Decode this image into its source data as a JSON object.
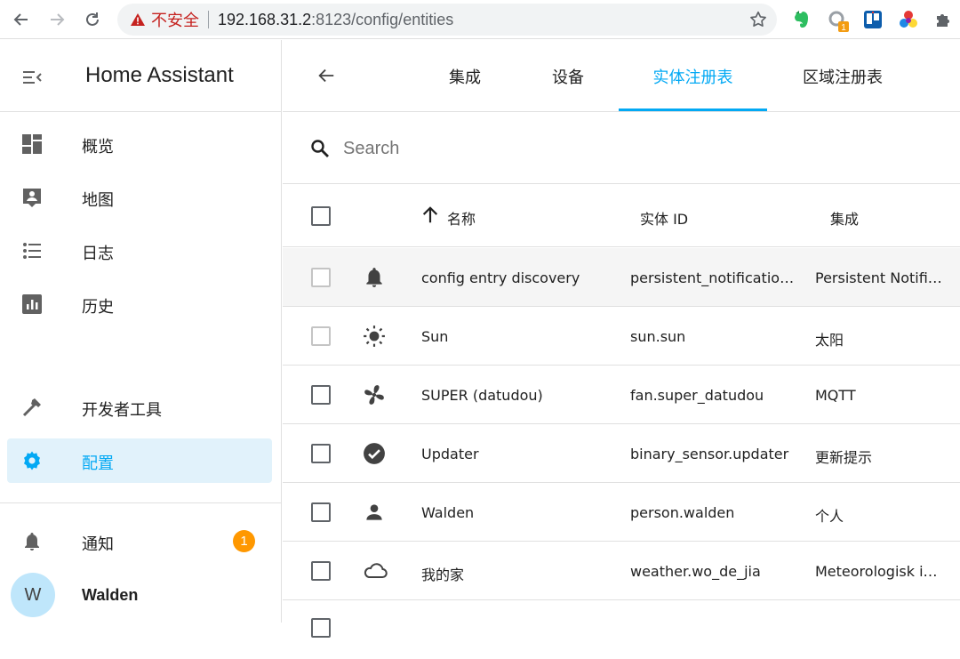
{
  "browser": {
    "insecure_label": "不安全",
    "url_host": "192.168.31.2",
    "url_rest": ":8123/config/entities",
    "ext_badge": "1"
  },
  "sidebar": {
    "title": "Home Assistant",
    "items": [
      {
        "label": "概览",
        "icon": "dashboard-icon"
      },
      {
        "label": "地图",
        "icon": "map-account-icon"
      },
      {
        "label": "日志",
        "icon": "list-icon"
      },
      {
        "label": "历史",
        "icon": "chart-box-icon"
      },
      {
        "label": "开发者工具",
        "icon": "hammer-icon"
      },
      {
        "label": "配置",
        "icon": "cog-icon"
      },
      {
        "label": "通知",
        "icon": "bell-icon"
      }
    ],
    "notification_count": "1",
    "user": {
      "initial": "W",
      "name": "Walden"
    },
    "accent": "#03a9f4"
  },
  "main": {
    "tabs": [
      {
        "label": "集成"
      },
      {
        "label": "设备"
      },
      {
        "label": "实体注册表"
      },
      {
        "label": "区域注册表"
      }
    ],
    "active_tab": "实体注册表",
    "search": {
      "placeholder": "Search",
      "value": ""
    },
    "columns": {
      "name": "名称",
      "entity_id": "实体 ID",
      "integration": "集成"
    },
    "rows": [
      {
        "name": "config entry discovery",
        "entity_id": "persistent_notificatio…",
        "integration": "Persistent Notifi…",
        "icon": "bell-icon"
      },
      {
        "name": "Sun",
        "entity_id": "sun.sun",
        "integration": "太阳",
        "icon": "sun-icon"
      },
      {
        "name": "SUPER (datudou)",
        "entity_id": "fan.super_datudou",
        "integration": "MQTT",
        "icon": "fan-icon"
      },
      {
        "name": "Updater",
        "entity_id": "binary_sensor.updater",
        "integration": "更新提示",
        "icon": "check-circle-icon"
      },
      {
        "name": "Walden",
        "entity_id": "person.walden",
        "integration": "个人",
        "icon": "person-icon"
      },
      {
        "name": "我的家",
        "entity_id": "weather.wo_de_jia",
        "integration": "Meteorologisk i…",
        "icon": "cloud-icon"
      }
    ]
  }
}
